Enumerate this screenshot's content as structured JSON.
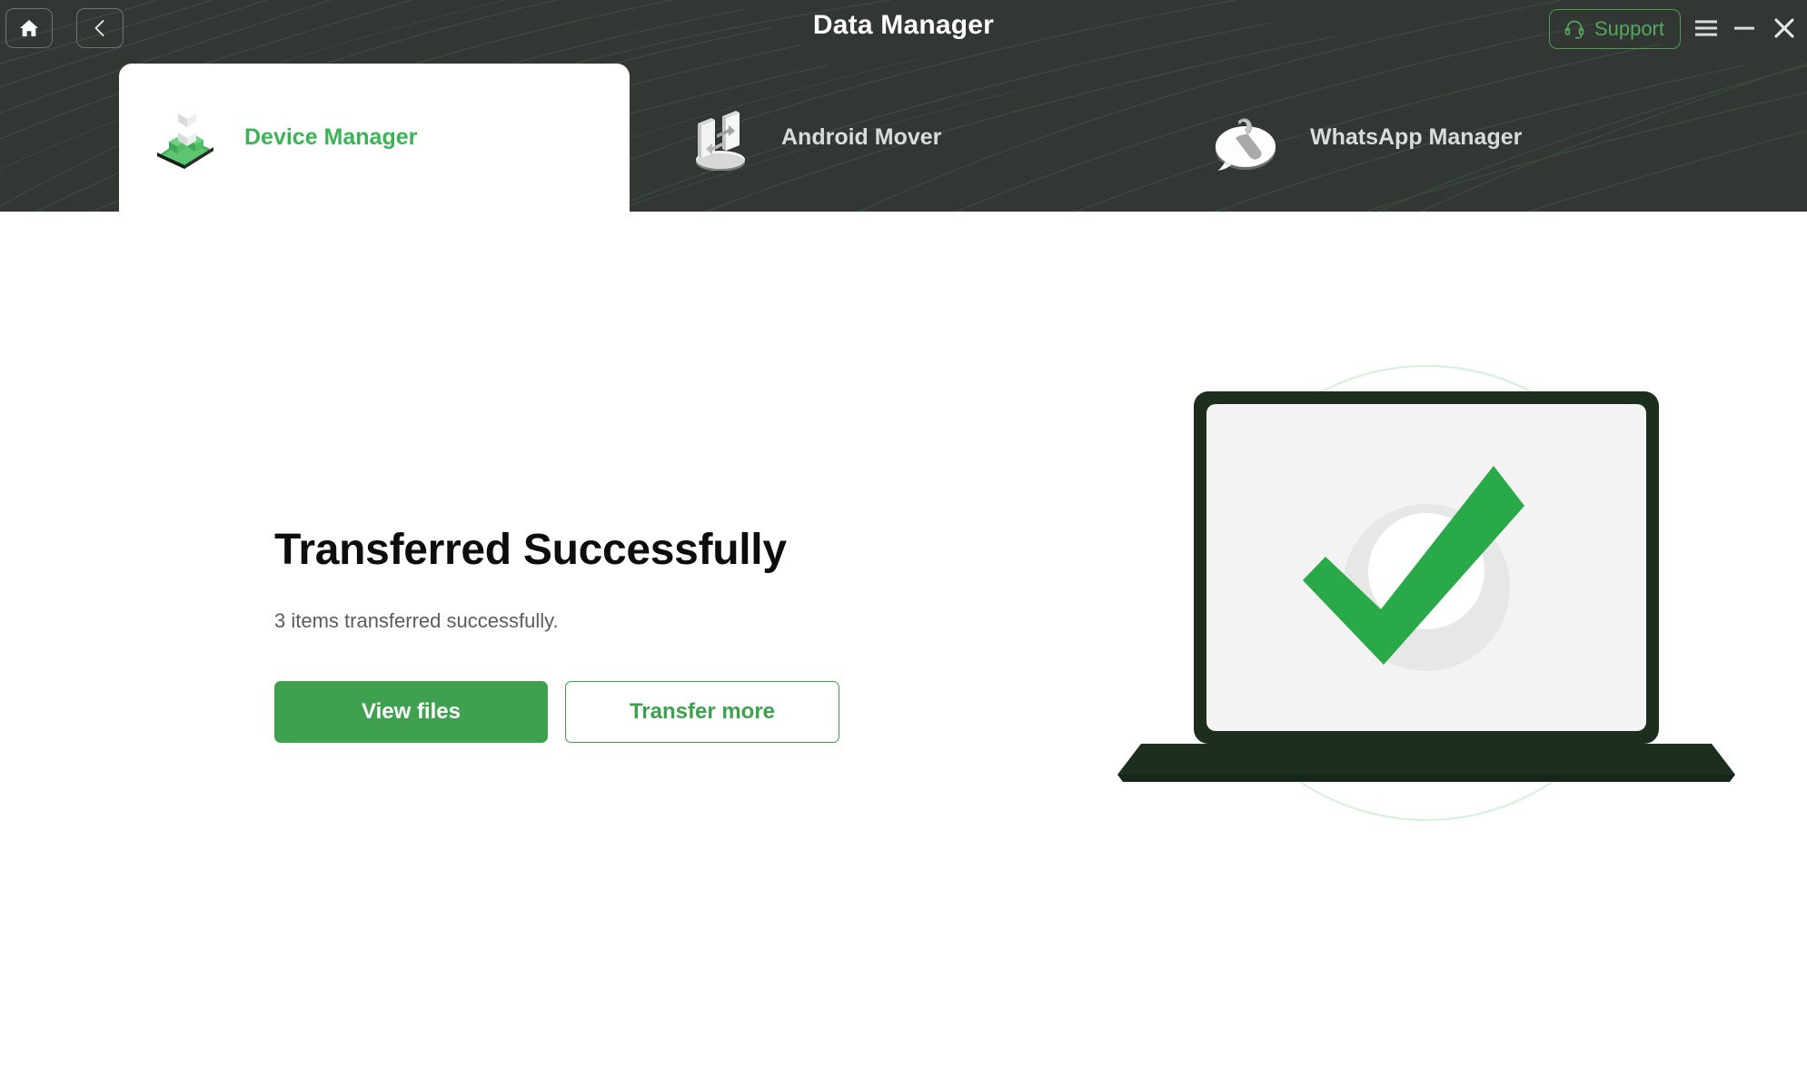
{
  "window": {
    "title": "Data Manager",
    "home_icon": "home-icon",
    "back_icon": "chevron-left-icon",
    "support_label": "Support",
    "support_icon": "headset-icon",
    "menu_icon": "hamburger-menu-icon",
    "minimize_icon": "minimize-icon",
    "close_icon": "close-icon"
  },
  "tabs": [
    {
      "id": "device-manager",
      "label": "Device Manager",
      "icon": "device-manager-icon",
      "active": true
    },
    {
      "id": "android-mover",
      "label": "Android Mover",
      "icon": "android-mover-icon",
      "active": false
    },
    {
      "id": "whatsapp-manager",
      "label": "WhatsApp Manager",
      "icon": "whatsapp-manager-icon",
      "active": false
    }
  ],
  "main": {
    "status_title": "Transferred Successfully",
    "status_subtitle": "3 items transferred successfully.",
    "view_files_label": "View files",
    "transfer_more_label": "Transfer more",
    "illustration": "laptop-with-green-checkmark"
  },
  "colors": {
    "header_bg": "#323734",
    "accent_green": "#3fa04f",
    "tab_active_text": "#3cb356",
    "support_green": "#54a75d",
    "tab_inactive_text": "#d9dcda",
    "title_text": "#0d0d0d",
    "subtitle_text": "#5c5c5c",
    "laptop_frame": "#1e2e1e",
    "laptop_screen": "#f2f3f2",
    "checkmark_green": "#2aa948"
  }
}
